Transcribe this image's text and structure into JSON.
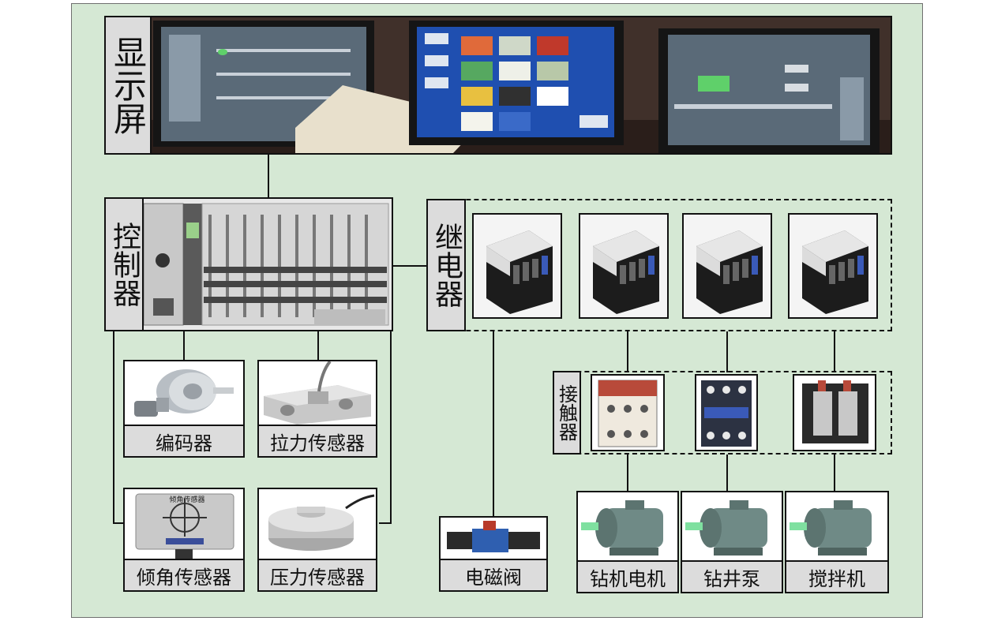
{
  "display": {
    "label": "显示屏"
  },
  "controller": {
    "label": "控制器"
  },
  "relay": {
    "label": "继电器"
  },
  "contactor": {
    "label": "接触器"
  },
  "sensors": {
    "encoder": "编码器",
    "tension": "拉力传感器",
    "tilt": "倾角传感器",
    "pressure": "压力传感器",
    "tilt_device_text": "倾角传感器"
  },
  "valve": {
    "label": "电磁阀"
  },
  "motors": {
    "drill_motor": "钻机电机",
    "well_pump": "钻井泵",
    "mixer": "搅拌机"
  },
  "colors": {
    "panel_bg": "#d5e8d4",
    "label_bg": "#dcdcdc",
    "screen_blue": "#1f4fb0",
    "motor_teal": "#6f8a86",
    "shaft_green": "#7fe0a0"
  }
}
